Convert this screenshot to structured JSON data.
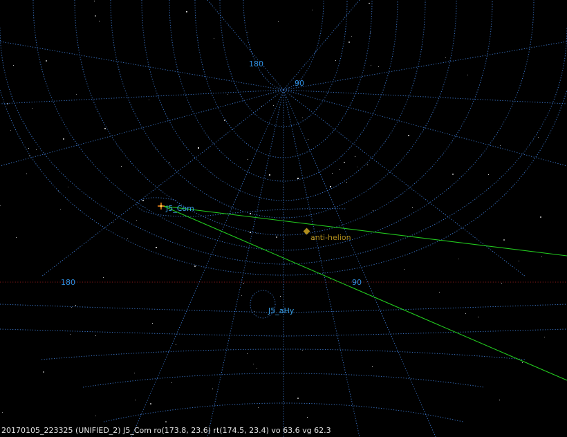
{
  "grid_labels": {
    "upper_left": "180",
    "upper_right": "90",
    "lower_left": "180",
    "lower_right": "90"
  },
  "radiants": {
    "primary": "J5_Com",
    "secondary": "J5_aHy",
    "anti_helion": "anti-helion"
  },
  "status_line": "20170105_223325 (UNIFIED_2) J5_Com ro(173.8, 23.6) rt(174.5, 23.4) vo 63.6 vg 62.3",
  "colors": {
    "background": "#000000",
    "grid": "#3a73c4",
    "grid_label": "#2f8fe0",
    "meteor_trail": "#22c81e",
    "anti_helion": "#b08d1c",
    "radiant_marker": "#ff8c1a"
  }
}
